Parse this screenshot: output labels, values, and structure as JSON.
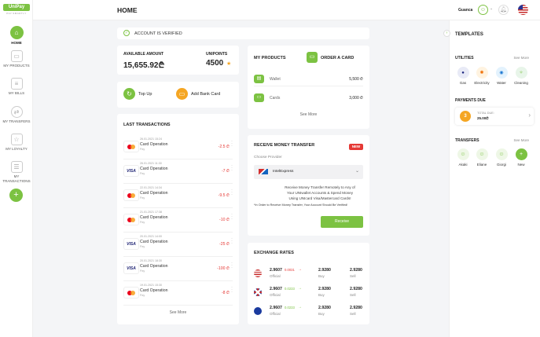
{
  "logo": {
    "brand": "UniPay",
    "tagline": "PAY.SMARTLY"
  },
  "header": {
    "title": "HOME",
    "username": "Guanca"
  },
  "nav": [
    {
      "label": "HOME"
    },
    {
      "label": "MY PRODUCTS"
    },
    {
      "label": "MY BILLS"
    },
    {
      "label": "MY TRANSFERS"
    },
    {
      "label": "MY LOYALTY"
    },
    {
      "label": "MY TRANSACTIONS"
    }
  ],
  "verified": {
    "text": "ACCOUNT IS VERIFIED"
  },
  "balance": {
    "label": "AVAILABLE AMOUNT",
    "value": "15,655.92₾",
    "points_label": "UNIPOINTS",
    "points": "4500"
  },
  "actions": {
    "topup": "Top Up",
    "addcard": "Add Bank Card"
  },
  "transactions": {
    "title": "LAST TRANSACTIONS",
    "items": [
      {
        "date": "26.01.2021 15:24",
        "name": "Card Operation",
        "sub": "Pay",
        "amount": "-2.5 ₾",
        "brand": "mc"
      },
      {
        "date": "26.01.2021 11:30",
        "name": "Card Operation",
        "sub": "Pay",
        "amount": "-7 ₾",
        "brand": "visa"
      },
      {
        "date": "22.01.2021 14:34",
        "name": "Card Operation",
        "sub": "Pay",
        "amount": "-9.5 ₾",
        "brand": "mc"
      },
      {
        "date": "21.01.2021 17:38",
        "name": "Card Operation",
        "sub": "Pay",
        "amount": "-10 ₾",
        "brand": "mc"
      },
      {
        "date": "20.01.2021 14:00",
        "name": "Card Operation",
        "sub": "Pay",
        "amount": "-25 ₾",
        "brand": "visa"
      },
      {
        "date": "20.01.2021 18:30",
        "name": "Card Operation",
        "sub": "Pay",
        "amount": "-100 ₾",
        "brand": "visa"
      },
      {
        "date": "19.01.2021 15:30",
        "name": "Card Operation",
        "sub": "Pay",
        "amount": "-8 ₾",
        "brand": "mc"
      }
    ],
    "see_more": "See More"
  },
  "products": {
    "title": "MY PRODUCTS",
    "order": "ORDER A CARD",
    "items": [
      {
        "name": "Wallet",
        "value": "5,500 ₾"
      },
      {
        "name": "Cards",
        "value": "3,000 ₾"
      }
    ],
    "see_more": "See More"
  },
  "receive": {
    "title": "Receive Money Transfer",
    "badge": "NEW",
    "choose": "Choose Provider",
    "provider": "IntelExpress",
    "description": "Receive Money Transfer Remotely to Any of Your UNIwallet Accounts & Spend Money Using UNIcard Visa/Mastercard Cards!",
    "note": "*In Order to Receive Money Transfer, Your Account Should Be Verified!",
    "button": "Receive"
  },
  "exchange": {
    "title": "EXCHANGE RATES",
    "rows": [
      {
        "rate": "2.9607",
        "change": "0.0031",
        "dir": "down",
        "label": "Official",
        "buy": "2.9280",
        "buy_label": "Buy",
        "sell": "2.9280",
        "sell_label": "Sell",
        "flag": "usa"
      },
      {
        "rate": "2.9607",
        "change": "0.0233",
        "dir": "up",
        "label": "Official",
        "buy": "2.9280",
        "buy_label": "Buy",
        "sell": "2.9280",
        "sell_label": "Sell",
        "flag": "uk"
      },
      {
        "rate": "2.9607",
        "change": "0.0233",
        "dir": "up",
        "label": "Official",
        "buy": "2.9280",
        "buy_label": "Buy",
        "sell": "2.9280",
        "sell_label": "Sell",
        "flag": "eu"
      }
    ]
  },
  "right": {
    "title": "TEMPLATES",
    "utilities": {
      "title": "UTILITIES",
      "see_more": "See More",
      "items": [
        {
          "label": "Gas"
        },
        {
          "label": "Electricity"
        },
        {
          "label": "Water"
        },
        {
          "label": "Cleaning"
        }
      ]
    },
    "payments_due": {
      "title": "PAYMENTS DUE",
      "count": "3",
      "total_label": "TOTAL DUE:",
      "total": "25.00₾"
    },
    "transfers": {
      "title": "TRANSFERS",
      "see_more": "See More",
      "items": [
        {
          "label": "Akaki"
        },
        {
          "label": "Eliane"
        },
        {
          "label": "Giorgi"
        },
        {
          "label": "New"
        }
      ]
    }
  },
  "colors": {
    "accent": "#7cc242",
    "negative": "#e53935",
    "badge": "#e53935"
  }
}
